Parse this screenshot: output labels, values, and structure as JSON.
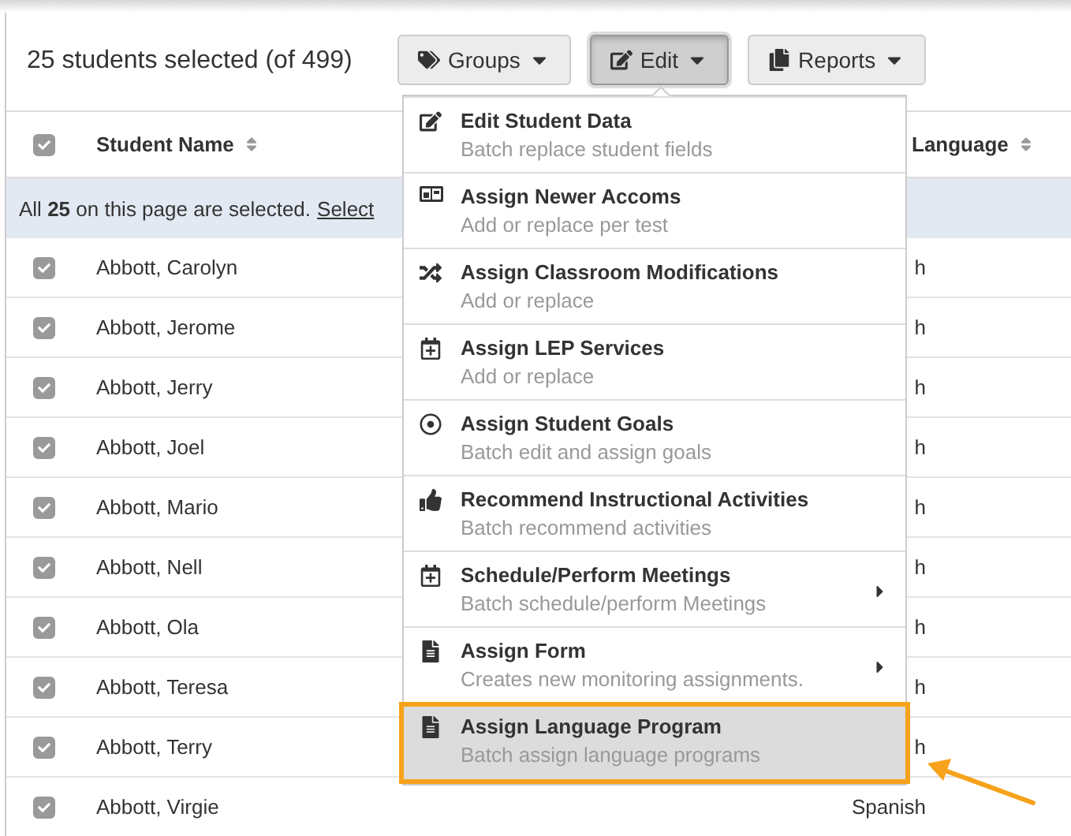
{
  "toolbar": {
    "selection_summary": "25 students selected (of 499)",
    "buttons": [
      {
        "label": "Groups",
        "pressed": false
      },
      {
        "label": "Edit",
        "pressed": true
      },
      {
        "label": "Reports",
        "pressed": false
      }
    ]
  },
  "table": {
    "header_checked": true,
    "columns": [
      {
        "label": "Student Name"
      },
      {
        "label": "Language"
      }
    ],
    "banner": {
      "text": "All **25** on this page are selected.",
      "link": "Select"
    },
    "rows": [
      {
        "name": "Abbott, Carolyn",
        "checked": true,
        "language": "h"
      },
      {
        "name": "Abbott, Jerome",
        "checked": true,
        "language": "h"
      },
      {
        "name": "Abbott, Jerry",
        "checked": true,
        "language": "h"
      },
      {
        "name": "Abbott, Joel",
        "checked": true,
        "language": "h"
      },
      {
        "name": "Abbott, Mario",
        "checked": true,
        "language": "h"
      },
      {
        "name": "Abbott, Nell",
        "checked": true,
        "language": "h"
      },
      {
        "name": "Abbott, Ola",
        "checked": true,
        "language": "h"
      },
      {
        "name": "Abbott, Teresa",
        "checked": true,
        "language": "h"
      },
      {
        "name": "Abbott, Terry",
        "checked": true,
        "language": "h"
      },
      {
        "name": "Abbott, Virgie",
        "checked": true,
        "language": "Spanish"
      }
    ]
  },
  "edit_menu": {
    "items": [
      {
        "title": "Edit Student Data",
        "subtitle": "Batch replace student fields",
        "submenu": false,
        "selected": false
      },
      {
        "title": "Assign Newer Accoms",
        "subtitle": "Add or replace per test",
        "submenu": false,
        "selected": false
      },
      {
        "title": "Assign Classroom Modifications",
        "subtitle": "Add or replace",
        "submenu": false,
        "selected": false
      },
      {
        "title": "Assign LEP Services",
        "subtitle": "Add or replace",
        "submenu": false,
        "selected": false
      },
      {
        "title": "Assign Student Goals",
        "subtitle": "Batch edit and assign goals",
        "submenu": false,
        "selected": false
      },
      {
        "title": "Recommend Instructional Activities",
        "subtitle": "Batch recommend activities",
        "submenu": false,
        "selected": false
      },
      {
        "title": "Schedule/Perform Meetings",
        "subtitle": "Batch schedule/perform Meetings",
        "submenu": true,
        "selected": false
      },
      {
        "title": "Assign Form",
        "subtitle": "Creates new monitoring assignments.",
        "submenu": true,
        "selected": false
      },
      {
        "title": "Assign Language Program",
        "subtitle": "Batch assign language programs",
        "submenu": false,
        "selected": true
      }
    ]
  }
}
